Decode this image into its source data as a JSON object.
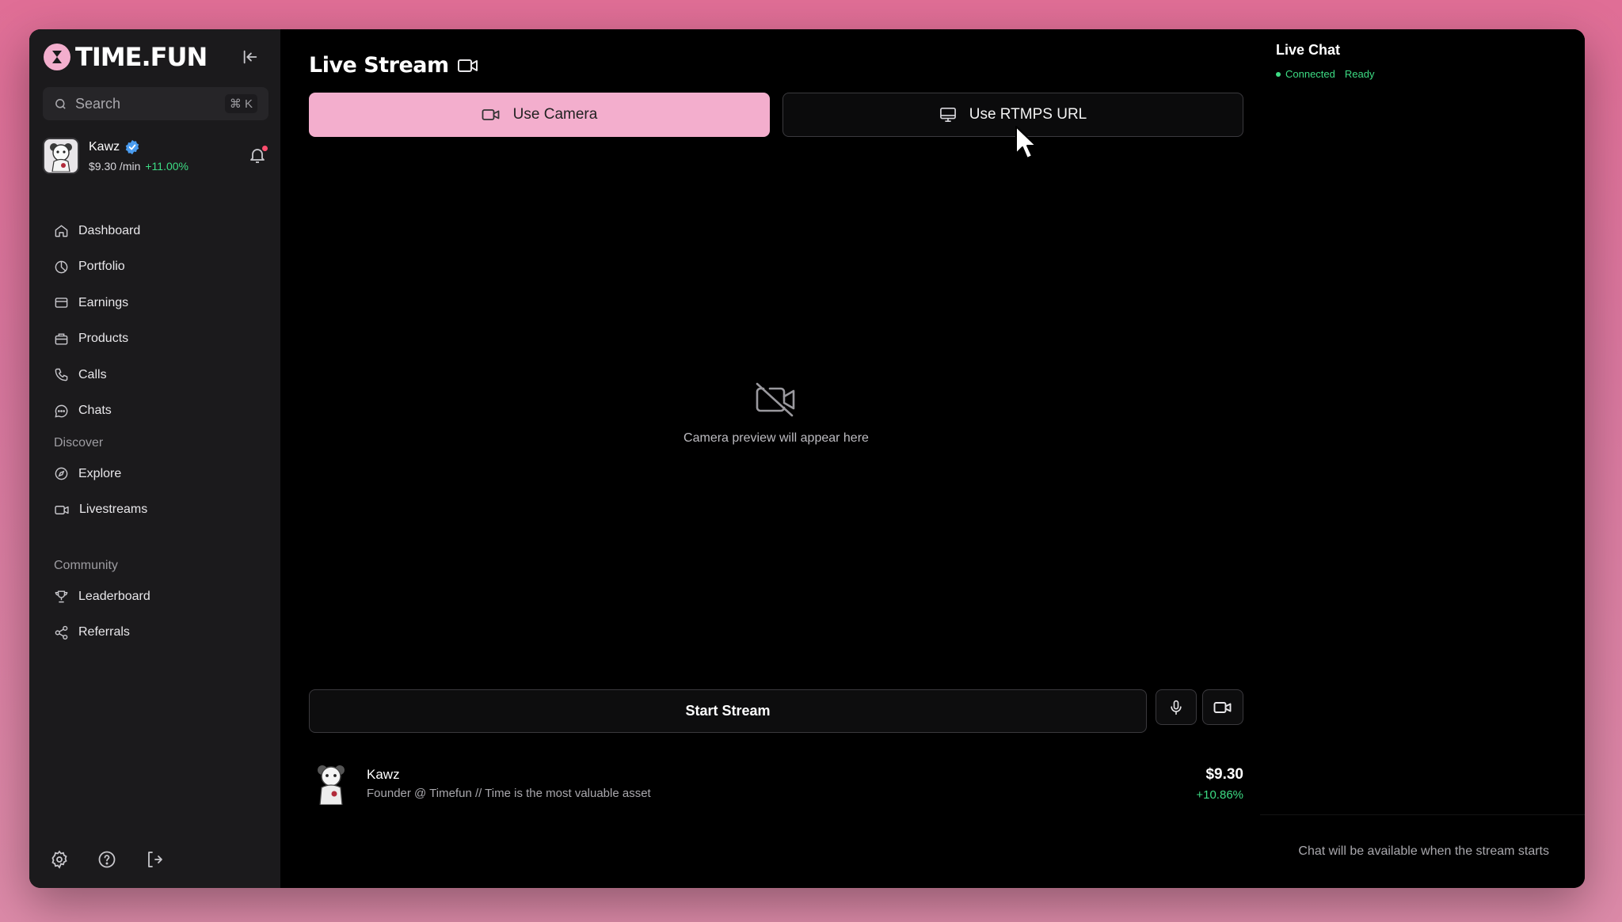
{
  "brand": {
    "name": "TIME.FUN"
  },
  "search": {
    "placeholder": "Search",
    "shortcut": "⌘ K"
  },
  "user": {
    "name": "Kawz",
    "rate": "$9.30 /min",
    "change": "+11.00%"
  },
  "nav": {
    "main": [
      {
        "label": "Dashboard",
        "icon": "home-icon"
      },
      {
        "label": "Portfolio",
        "icon": "pie-chart-icon"
      },
      {
        "label": "Earnings",
        "icon": "wallet-icon"
      },
      {
        "label": "Products",
        "icon": "package-icon"
      },
      {
        "label": "Calls",
        "icon": "phone-icon"
      },
      {
        "label": "Chats",
        "icon": "message-icon"
      }
    ],
    "discover_title": "Discover",
    "discover": [
      {
        "label": "Explore",
        "icon": "compass-icon"
      },
      {
        "label": "Livestreams",
        "icon": "video-icon"
      }
    ],
    "community_title": "Community",
    "community": [
      {
        "label": "Leaderboard",
        "icon": "trophy-icon"
      },
      {
        "label": "Referrals",
        "icon": "share-icon"
      }
    ]
  },
  "footer_icons": [
    "gear-icon",
    "help-icon",
    "logout-icon"
  ],
  "main": {
    "title": "Live Stream",
    "use_camera": "Use Camera",
    "use_rtmps": "Use RTMPS URL",
    "preview_text": "Camera preview will appear here",
    "start_stream": "Start Stream"
  },
  "streamer": {
    "name": "Kawz",
    "bio": "Founder @ Timefun // Time is the most valuable asset",
    "price": "$9.30",
    "change": "+10.86%"
  },
  "chat": {
    "title": "Live Chat",
    "status_connected": "Connected",
    "status_ready": "Ready",
    "empty_text": "Chat will be available when the stream starts"
  },
  "colors": {
    "accent": "#f3aecd",
    "positive": "#3ddc84",
    "sidebar": "#1b1a1c"
  }
}
